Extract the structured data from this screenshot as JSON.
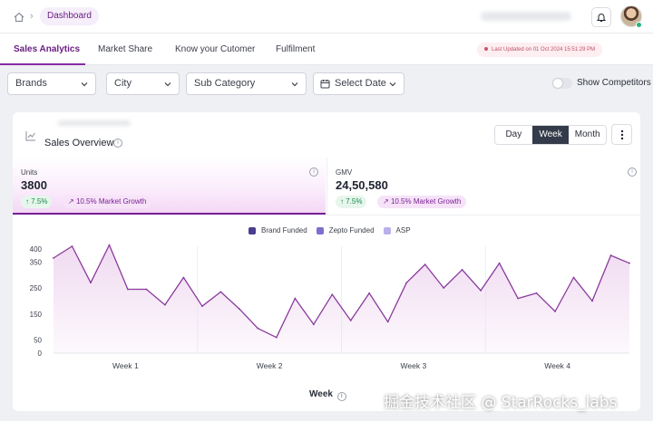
{
  "breadcrumb": {
    "home_icon": "home-icon",
    "separator": "›",
    "current": "Dashboard"
  },
  "tabs": [
    {
      "label": "Sales Analytics",
      "active": true
    },
    {
      "label": "Market Share",
      "active": false
    },
    {
      "label": "Know your Cutomer",
      "active": false
    },
    {
      "label": "Fulfilment",
      "active": false
    }
  ],
  "last_updated": "Last Updated on 01 Oct 2024 15:51:29 PM",
  "filters": {
    "brands": "Brands",
    "city": "City",
    "sub_category": "Sub Category",
    "select_date": "Select Date",
    "show_competitors": "Show Competitors"
  },
  "card": {
    "title": "Sales Overview",
    "granularity": [
      "Day",
      "Week",
      "Month"
    ],
    "active_granularity": "Week",
    "metrics": [
      {
        "label": "Units",
        "value": "3800",
        "growth": "7.5%",
        "market_growth": "10.5% Market Growth"
      },
      {
        "label": "GMV",
        "value": "24,50,580",
        "growth": "7.5%",
        "market_growth": "10.5% Market Growth"
      }
    ]
  },
  "chart_data": {
    "type": "area",
    "legend": [
      {
        "name": "Brand Funded",
        "color": "#4a3d8f"
      },
      {
        "name": "Zepto Funded",
        "color": "#7b6fd0"
      },
      {
        "name": "ASP",
        "color": "#b9b0ea"
      }
    ],
    "xlabel": "Week",
    "x_ticks": [
      "Week 1",
      "Week 2",
      "Week 3",
      "Week 4"
    ],
    "y_ticks": [
      0,
      50,
      150,
      250,
      350,
      400
    ],
    "ylim": [
      0,
      410
    ],
    "values": [
      365,
      410,
      270,
      415,
      245,
      245,
      185,
      290,
      180,
      235,
      170,
      95,
      60,
      210,
      110,
      225,
      125,
      230,
      120,
      270,
      340,
      250,
      320,
      240,
      345,
      210,
      230,
      160,
      290,
      200,
      375,
      345
    ],
    "line_color": "#8a3a9c",
    "fill_color": "#efd8f0"
  },
  "watermark": "掘金技术社区 @ StarRocks_labs"
}
